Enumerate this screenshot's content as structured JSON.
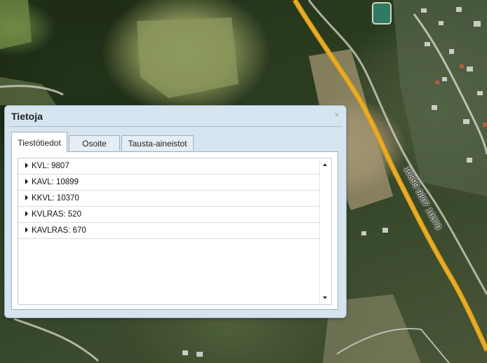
{
  "map": {
    "road_label": "10899 9807 10370",
    "road_color": "#e0a21a"
  },
  "popup": {
    "title": "Tietoja",
    "close_symbol": "×",
    "tabs": [
      {
        "label": "Tiestötiedot",
        "active": true
      },
      {
        "label": "Osoite",
        "active": false
      },
      {
        "label": "Tausta-aineistot",
        "active": false
      }
    ],
    "rows": [
      {
        "label": "KVL: 9807"
      },
      {
        "label": "KAVL: 10899"
      },
      {
        "label": "KKVL: 10370"
      },
      {
        "label": "KVLRAS: 520"
      },
      {
        "label": "KAVLRAS: 670"
      }
    ]
  }
}
